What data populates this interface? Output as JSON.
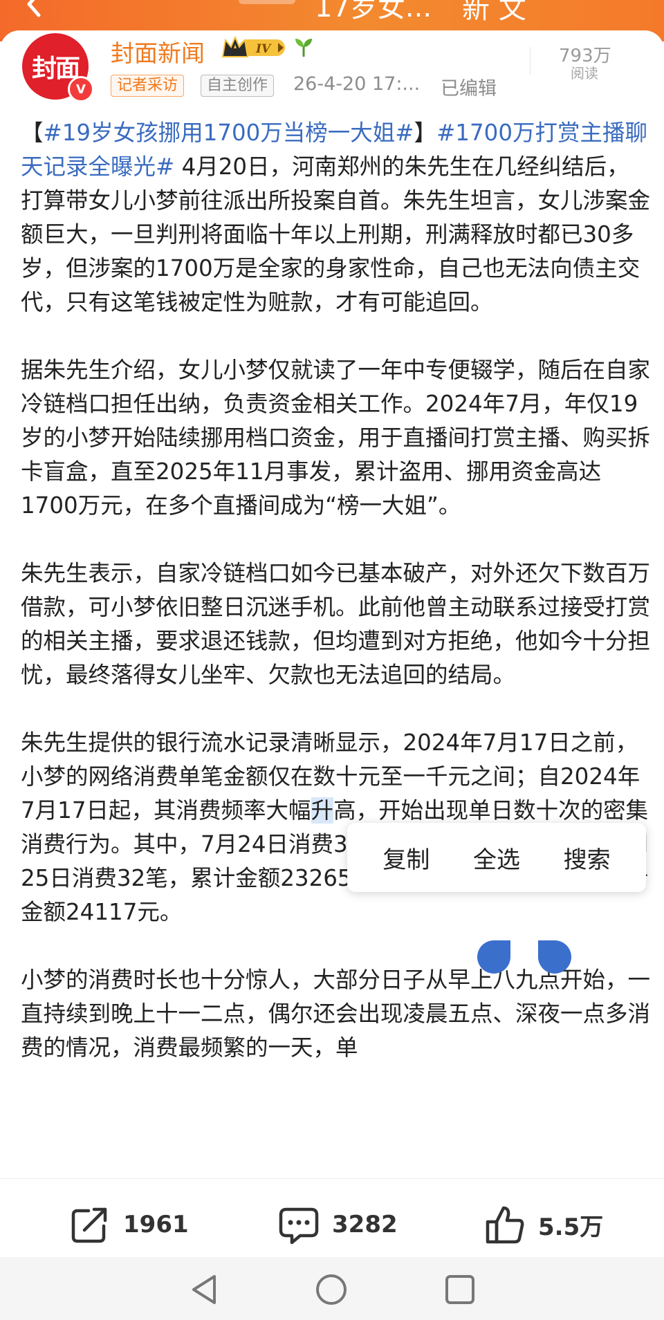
{
  "topbar": {
    "title": "17岁女...",
    "right_text": "新 文"
  },
  "author": {
    "name": "封面新闻",
    "logo_text": "封面",
    "level": "IV",
    "verified_mark": "V",
    "tags": [
      "记者采访",
      "自主创作"
    ],
    "time": "26-4-20 17:...",
    "edited": "已编辑",
    "reads_count": "793万",
    "reads_label": "阅读"
  },
  "article": {
    "p1_bracket_open": "【",
    "p1_tag1": "#19岁女孩挪用1700万当榜一大姐#",
    "p1_bracket_close": "】",
    "p1_tag2": "#1700万打赏主播聊天记录全曝光#",
    "p1_text": " 4月20日，河南郑州的朱先生在几经纠结后，打算带女儿小梦前往派出所投案自首。朱先生坦言，女儿涉案金额巨大，一旦判刑将面临十年以上刑期，刑满释放时都已30多岁，但涉案的1700万是全家的身家性命，自己也无法向债主交代，只有这笔钱被定性为赃款，才有可能追回。",
    "p2": "据朱先生介绍，女儿小梦仅就读了一年中专便辍学，随后在自家冷链档口担任出纳，负责资金相关工作。2024年7月，年仅19岁的小梦开始陆续挪用档口资金，用于直播间打赏主播、购买拆卡盲盒，直至2025年11月事发，累计盗用、挪用资金高达1700万元，在多个直播间成为“榜一大姐”。",
    "p3": "朱先生表示，自家冷链档口如今已基本破产，对外还欠下数百万借款，可小梦依旧整日沉迷手机。此前他曾主动联系过接受打赏的相关主播，要求退还钱款，但均遭到对方拒绝，他如今十分担忧，最终落得女儿坐牢、欠款也无法追回的结局。",
    "p4_before": "朱先生提供的银行流水记录清晰显示，2024年7月17日之前，小梦的网络消费单笔金额仅在数十元至一千元之间；自2024年7月17日起，其消费频率大幅",
    "p4_selected": "升",
    "p4_after": "高，开始出现单日数十次的密集消费行为。其中，7月24日消费33笔，累计金额37278元；7月25日消费32笔，累计金额23265元；7月26日消费37笔，累计金额24117元。",
    "p5": "小梦的消费时长也十分惊人，大部分日子从早上八九点开始，一直持续到晚上十一二点，偶尔还会出现凌晨五点、深夜一点多消费的情况，消费最频繁的一天，单"
  },
  "context_menu": {
    "copy": "复制",
    "select_all": "全选",
    "search": "搜索"
  },
  "actions": {
    "share_count": "1961",
    "comment_count": "3282",
    "like_count": "5.5万"
  },
  "colors": {
    "brand_orange": "#f07a1e",
    "hashtag_blue": "#3a6bbf",
    "logo_red": "#e0202a",
    "selection_blue": "#3b6fcc"
  }
}
